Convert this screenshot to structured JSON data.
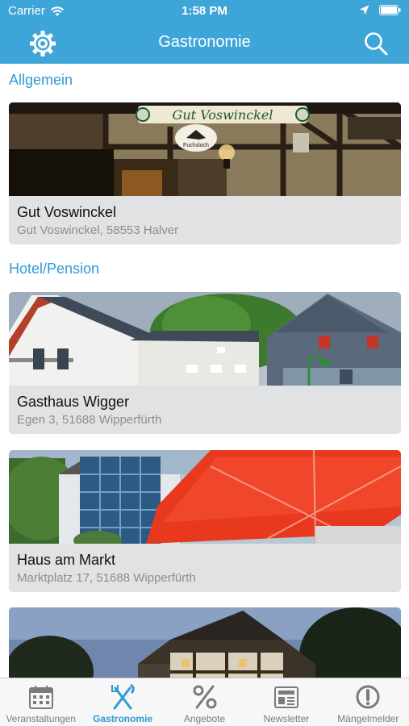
{
  "status_bar": {
    "carrier": "Carrier",
    "time": "1:58 PM"
  },
  "nav": {
    "title": "Gastronomie",
    "left_icon": "gear-icon",
    "right_icon": "search-icon"
  },
  "sections": [
    {
      "header": "Allgemein",
      "items": [
        {
          "name": "Gut Voswinckel",
          "address": "Gut Voswinckel, 58553 Halver",
          "sign_text": "Gut Voswinckel",
          "sub_sign": "Fuchsloch"
        }
      ]
    },
    {
      "header": "Hotel/Pension",
      "items": [
        {
          "name": "Gasthaus Wigger",
          "address": "Egen 3, 51688 Wipperfürth"
        },
        {
          "name": "Haus am Markt",
          "address": "Marktplatz 17, 51688 Wipperfürth"
        }
      ]
    }
  ],
  "tabs": [
    {
      "label": "Veranstaltungen",
      "icon": "calendar-icon",
      "active": false
    },
    {
      "label": "Gastronomie",
      "icon": "cutlery-icon",
      "active": true
    },
    {
      "label": "Angebote",
      "icon": "percent-icon",
      "active": false
    },
    {
      "label": "Newsletter",
      "icon": "newspaper-icon",
      "active": false
    },
    {
      "label": "Mängelmelder",
      "icon": "alert-icon",
      "active": false
    }
  ],
  "colors": {
    "accent": "#3ea5d8",
    "section_header": "#2f9ad4",
    "tab_inactive": "#7b7b7b"
  }
}
